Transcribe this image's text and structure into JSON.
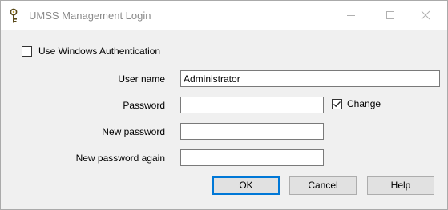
{
  "window": {
    "title": "UMSS Management Login",
    "icon": "key-icon"
  },
  "auth": {
    "windows_auth_label": "Use Windows Authentication",
    "windows_auth_checked": false
  },
  "form": {
    "username_label": "User name",
    "username_value": "Administrator",
    "password_label": "Password",
    "password_value": "",
    "change_label": "Change",
    "change_checked": true,
    "new_password_label": "New password",
    "new_password_value": "",
    "new_password_again_label": "New password again",
    "new_password_again_value": ""
  },
  "buttons": {
    "ok": "OK",
    "cancel": "Cancel",
    "help": "Help"
  },
  "colors": {
    "default_button_border": "#0078d7",
    "title_text": "#8a8a8a"
  }
}
